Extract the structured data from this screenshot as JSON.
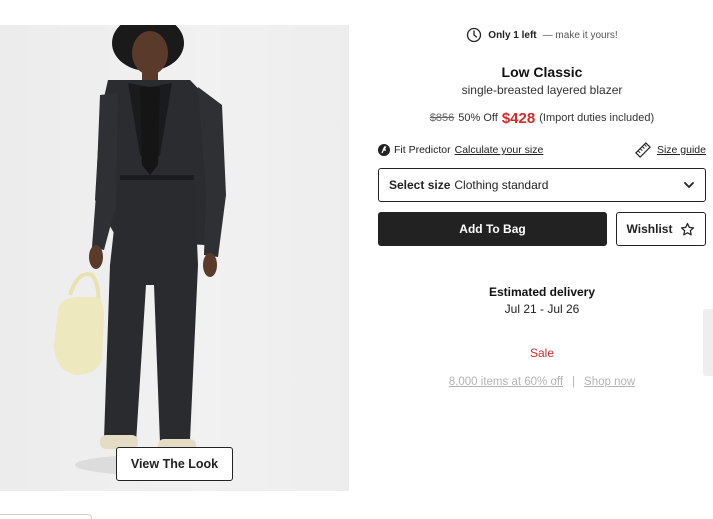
{
  "product": {
    "stock_bold": "Only 1 left",
    "stock_rest": "— make it yours!",
    "brand": "Low Classic",
    "name": "single-breasted layered blazer",
    "price_original": "$856",
    "discount": "50% Off",
    "price_sale": "$428",
    "duties_note": "(Import duties included)"
  },
  "fit": {
    "predictor_label": "Fit Predictor",
    "calculate_link": "Calculate your size",
    "size_guide_link": "Size guide"
  },
  "size_select": {
    "label": "Select size",
    "value": "Clothing standard"
  },
  "actions": {
    "add_to_bag": "Add To Bag",
    "wishlist": "Wishlist"
  },
  "delivery": {
    "heading": "Estimated delivery",
    "dates": "Jul 21 - Jul 26"
  },
  "sale": {
    "label": "Sale",
    "items_link": "8,000 items at 60% off",
    "separator": "|",
    "shop_link": "Shop now"
  },
  "image": {
    "view_look_button": "View The Look"
  },
  "colors": {
    "accent_red": "#d42a2a",
    "button_dark": "#222222",
    "muted_link": "#b4b4b4"
  },
  "icons": [
    "clock-icon",
    "fit-predictor-icon",
    "ruler-icon",
    "chevron-down-icon",
    "star-outline-icon"
  ]
}
